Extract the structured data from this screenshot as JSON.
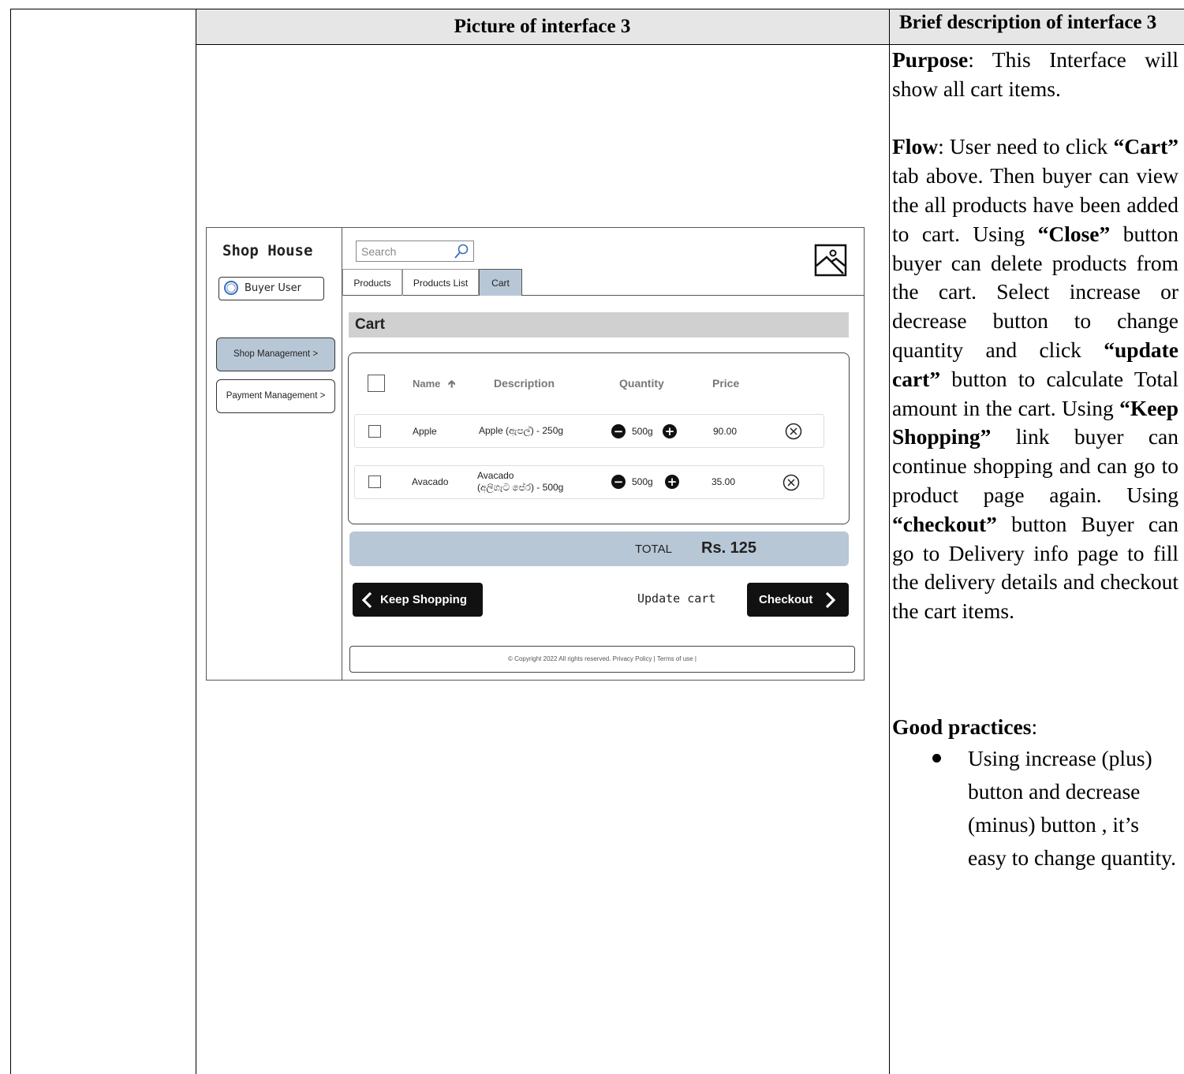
{
  "table": {
    "picture_header": "Picture of interface 3",
    "description_header": "Brief description of interface 3"
  },
  "description": {
    "purpose_label": "Purpose",
    "purpose_text": ": This Interface will show all cart items.",
    "flow_label": "Flow",
    "flow_1": ": User need to click ",
    "flow_cart": "“Cart”",
    "flow_2": " tab above. Then buyer can view the all products have been added to cart. Using ",
    "flow_close": "“Close”",
    "flow_3": " button buyer can delete products from the cart. Select increase or decrease button to change quantity and click ",
    "flow_update": "“update cart”",
    "flow_4": " button to calculate Total amount in the cart. Using ",
    "flow_keep": "“Keep Shopping”",
    "flow_5": " link buyer can continue shopping and can go to product page again. Using ",
    "flow_checkout": "“checkout”",
    "flow_6": " button Buyer can go to Delivery info page to fill the delivery details and checkout the cart items.",
    "good_label": "Good practices",
    "good_colon": ":",
    "good_items": [
      "Using increase (plus) button and decrease (minus) button , it’s easy to change quantity."
    ]
  },
  "mockup": {
    "brand": "Shop House",
    "user_label": "Buyer User",
    "nav": [
      {
        "label": "Shop Management >",
        "active": true
      },
      {
        "label": "Payment Management >",
        "active": false
      }
    ],
    "search_placeholder": "Search",
    "tabs": [
      {
        "label": "Products",
        "active": false
      },
      {
        "label": "Products List",
        "active": false
      },
      {
        "label": "Cart",
        "active": true
      }
    ],
    "cart_title": "Cart",
    "columns": {
      "name": "Name",
      "description": "Description",
      "quantity": "Quantity",
      "price": "Price"
    },
    "rows": [
      {
        "name": "Apple",
        "description": "Apple (ඇපල්) - 250g",
        "description_2": "",
        "quantity": "500g",
        "price": "90.00"
      },
      {
        "name": "Avacado",
        "description": "Avacado",
        "description_2": "(අලිගැට පේර) - 500g",
        "quantity": "500g",
        "price": "35.00"
      }
    ],
    "total_label": "TOTAL",
    "total_value": "Rs. 125",
    "keep_shopping": "Keep Shopping",
    "update_cart": "Update cart",
    "checkout": "Checkout",
    "footer": "© Copyright 2022 All rights reserved. Privacy Policy | Terms of use |"
  }
}
